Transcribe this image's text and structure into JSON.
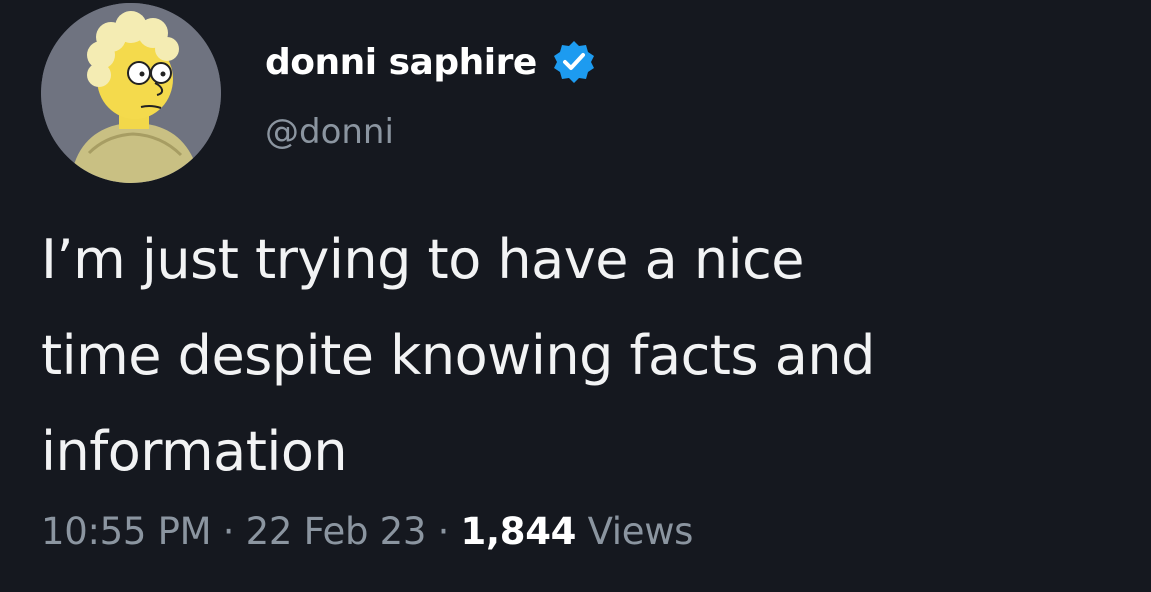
{
  "user": {
    "display_name": "donni saphire",
    "handle": "@donni",
    "verified": true,
    "verified_color": "#1d9bf0",
    "avatar_icon": "cartoon-character-avatar"
  },
  "tweet": {
    "lines": [
      "I’m just trying to have a nice",
      "time despite knowing facts and",
      "information"
    ]
  },
  "meta": {
    "time": "10:55 PM",
    "separator": "·",
    "date": "22 Feb 23",
    "views_count": "1,844",
    "views_label": "Views"
  },
  "colors": {
    "background": "#15181f",
    "secondary_text": "#8b95a0"
  }
}
